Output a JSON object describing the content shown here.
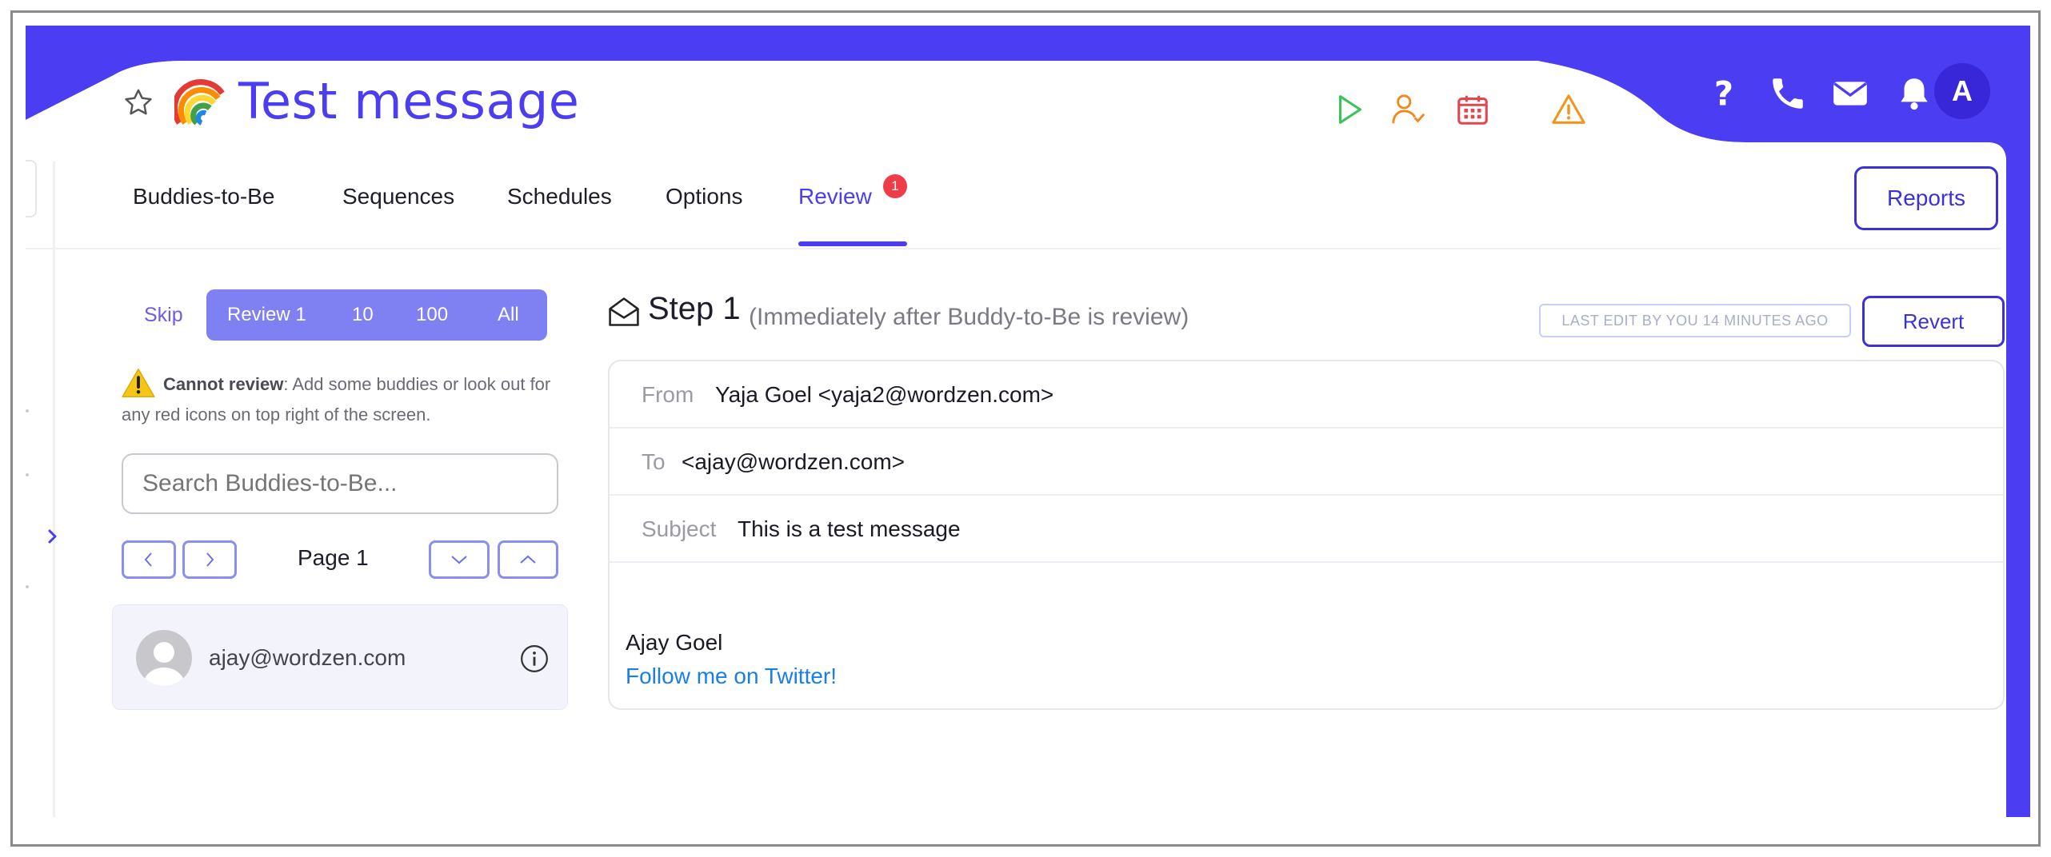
{
  "header": {
    "title": "Test message",
    "avatar_initial": "A"
  },
  "colors": {
    "brand": "#4a3df2",
    "header_bg": "#4a3df2",
    "badge": "#ee3d48",
    "link": "#1a7ee8"
  },
  "header_icons": [
    "play-icon",
    "user-check-icon",
    "calendar-icon",
    "warning-icon"
  ],
  "top_right_icons": [
    "help-icon",
    "phone-icon",
    "mail-icon",
    "bell-icon"
  ],
  "tabs": [
    {
      "label": "Buddies-to-Be"
    },
    {
      "label": "Sequences"
    },
    {
      "label": "Schedules"
    },
    {
      "label": "Options"
    },
    {
      "label": "Review",
      "badge": "1",
      "active": true
    }
  ],
  "reports_label": "Reports",
  "review_panel": {
    "skip_label": "Skip",
    "segments": [
      "Review 1",
      "10",
      "100",
      "All"
    ],
    "warning_bold": "Cannot review",
    "warning_text": ": Add some buddies or look out for any red icons on top right of the screen.",
    "search_placeholder": "Search Buddies-to-Be...",
    "page_label": "Page 1",
    "buddy_email": "ajay@wordzen.com"
  },
  "step": {
    "title": "Step 1",
    "subtitle": "(Immediately after Buddy-to-Be is review)",
    "last_edit": "LAST EDIT BY YOU 14 MINUTES AGO",
    "revert_label": "Revert"
  },
  "email": {
    "from_label": "From",
    "from_value": "Yaja Goel <yaja2@wordzen.com>",
    "to_label": "To",
    "to_value": "<ajay@wordzen.com>",
    "subject_label": "Subject",
    "subject_value": "This is a test message",
    "body_name": "Ajay Goel",
    "body_link": "Follow me on Twitter!"
  }
}
